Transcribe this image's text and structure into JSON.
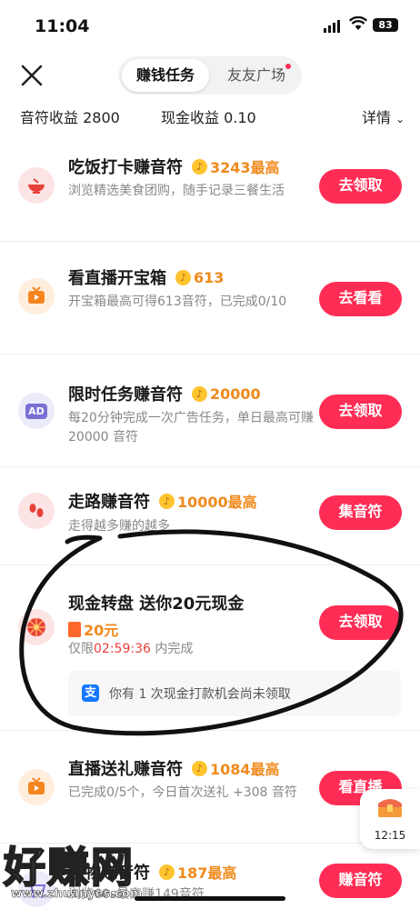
{
  "status_bar": {
    "time": "11:04",
    "battery": "83"
  },
  "header": {
    "tabs": [
      {
        "label": "赚钱任务"
      },
      {
        "label": "友友广场"
      }
    ]
  },
  "earnings": {
    "music_label": "音符收益 2800",
    "cash_label": "现金收益 0.10",
    "detail_label": "详情"
  },
  "tasks": [
    {
      "title": "吃饭打卡赚音符",
      "reward": "3243最高",
      "desc": "浏览精选美食团购，随手记录三餐生活",
      "button": "去领取"
    },
    {
      "title": "看直播开宝箱",
      "reward": "613",
      "desc": "开宝箱最高可得613音符，已完成0/10",
      "button": "去看看"
    },
    {
      "title": "限时任务赚音符",
      "reward": "20000",
      "desc": "每20分钟完成一次广告任务，单日最高可赚 20000 音符",
      "button": "去领取"
    },
    {
      "title": "走路赚音符",
      "reward": "10000最高",
      "desc": "走得越多赚的越多",
      "button": "集音符"
    },
    {
      "title": "现金转盘 送你20元现金",
      "reward": "20元",
      "desc_prefix": "仅限",
      "countdown": "02:59:36",
      "desc_suffix": "内完成",
      "button": "去领取",
      "cash_notice": "你有 1 次现金打款机会尚未领取"
    },
    {
      "title": "直播送礼赚音符",
      "reward": "1084最高",
      "desc": "已完成0/5个，今日首次送礼 +308 音符",
      "button": "看直播"
    },
    {
      "title": "购物赚音符",
      "reward": "187最高",
      "desc": "浏览60s最高赚149音符",
      "button": "赚音符"
    }
  ],
  "floating": {
    "timer": "12:15"
  },
  "watermark": {
    "text": "好赚网",
    "url": "www.zhuanyes.com"
  },
  "colors": {
    "accent": "#ff2d55",
    "reward": "#f08a1c"
  }
}
